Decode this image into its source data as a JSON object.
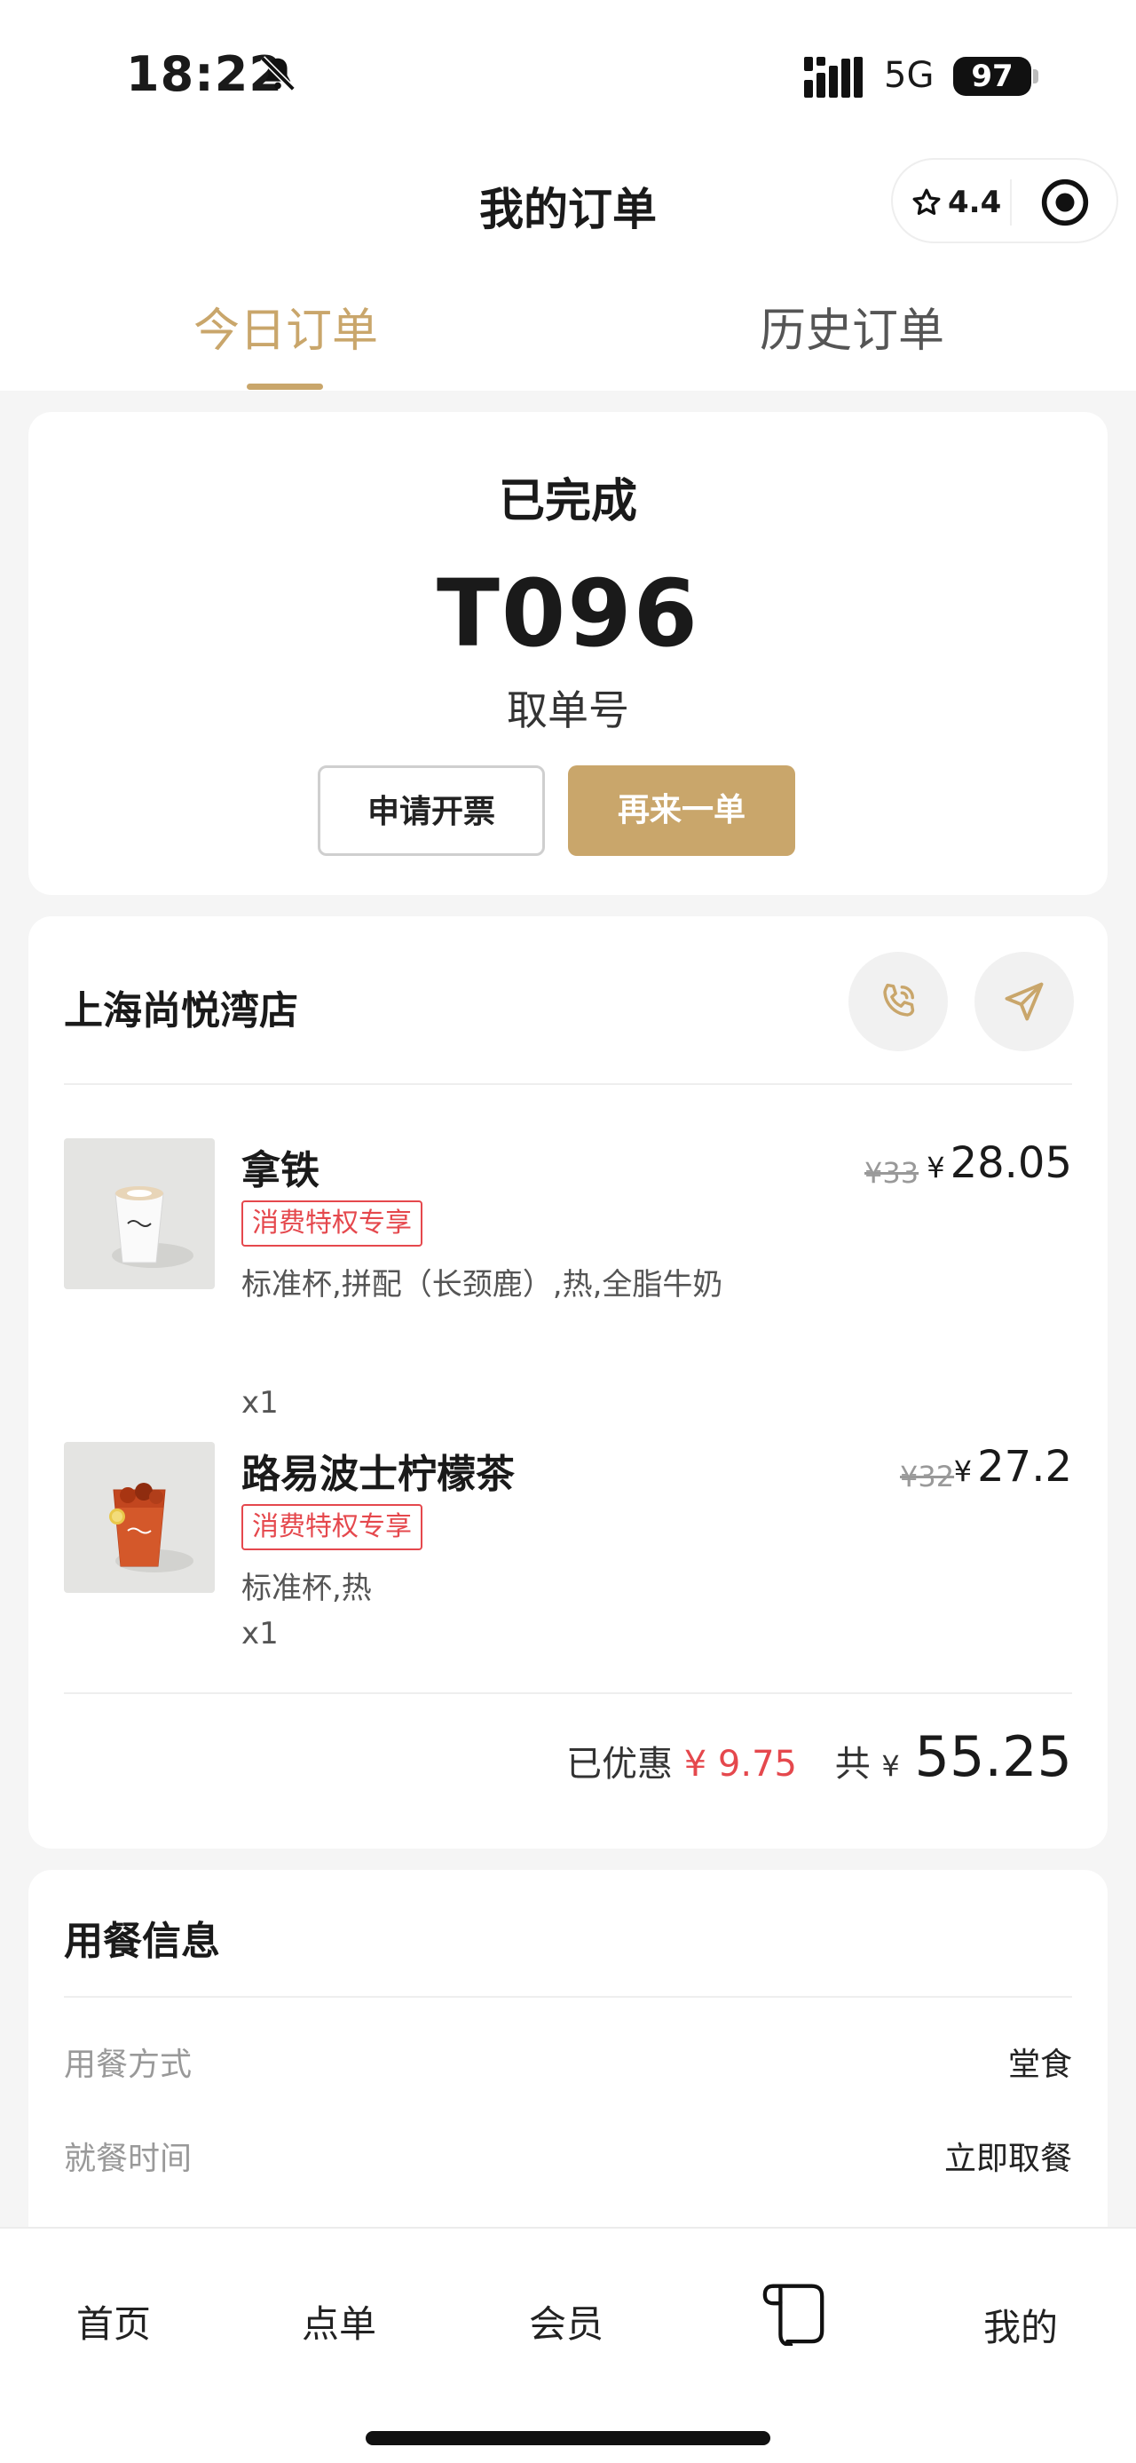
{
  "status_bar": {
    "time": "18:22",
    "network": "5G",
    "battery": "97"
  },
  "nav": {
    "title": "我的订单",
    "rating": "4.4"
  },
  "tabs": [
    {
      "label": "今日订单"
    },
    {
      "label": "历史订单"
    }
  ],
  "order": {
    "status": "已完成",
    "pickup_number": "T096",
    "pickup_label": "取单号",
    "invoice_label": "申请开票",
    "reorder_label": "再来一单"
  },
  "store": {
    "name": "上海尚悦湾店",
    "items": [
      {
        "name": "拿铁",
        "tag": "消费特权专享",
        "spec": "标准杯,拼配（长颈鹿）,热,全脂牛奶",
        "qty": "x1",
        "original_price": "¥33",
        "price": "28.05",
        "currency": "¥"
      },
      {
        "name": "路易波士柠檬茶",
        "tag": "消费特权专享",
        "spec": "标准杯,热",
        "qty": "x1",
        "original_price": "¥32",
        "price": "27.2",
        "currency": "¥"
      }
    ],
    "discount_label": "已优惠",
    "discount": "¥ 9.75",
    "total_label": "共",
    "currency": "¥",
    "total": "55.25"
  },
  "dining": {
    "title": "用餐信息",
    "rows": [
      {
        "label": "用餐方式",
        "value": "堂食"
      },
      {
        "label": "就餐时间",
        "value": "立即取餐"
      }
    ]
  },
  "tabbar": {
    "home": "首页",
    "order": "点单",
    "member": "会员",
    "mine": "我的"
  },
  "colors": {
    "accent": "#c9a66b",
    "discount": "#e5484d"
  }
}
